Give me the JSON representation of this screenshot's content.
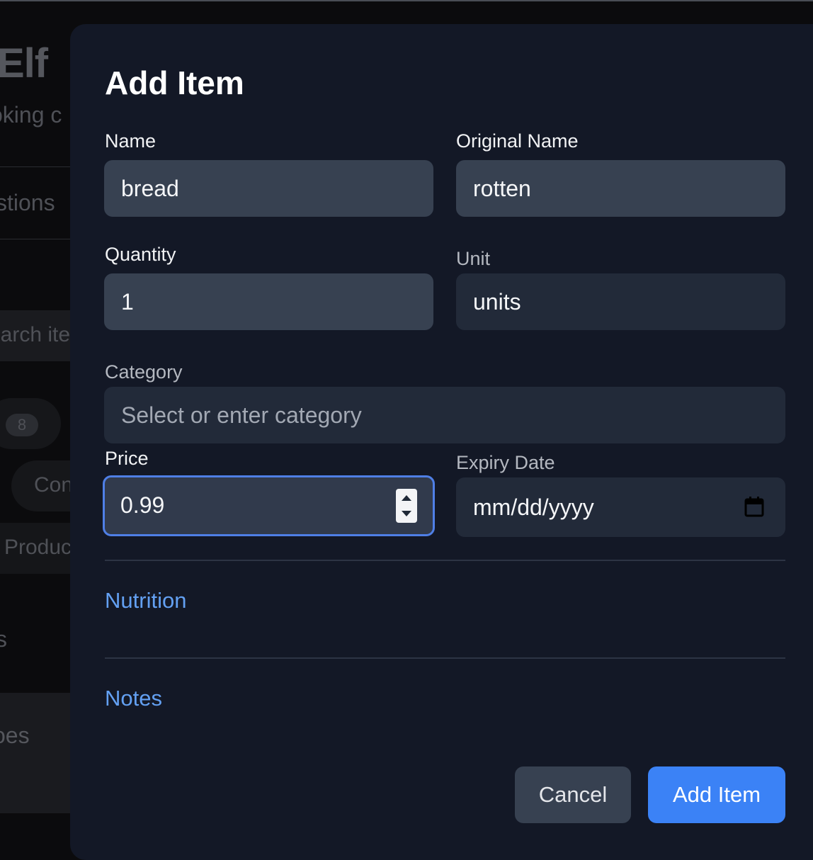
{
  "background": {
    "logo": "Elf",
    "tagline": "oking c",
    "nav_1": "stions",
    "search_placeholder": "earch ite",
    "count": "8",
    "chip": "Con",
    "products": "Produc",
    "nav_2": "s",
    "nav_3": "oes"
  },
  "modal": {
    "title": "Add Item",
    "fields": {
      "name": {
        "label": "Name",
        "value": "bread"
      },
      "original_name": {
        "label": "Original Name",
        "value": "rotten"
      },
      "quantity": {
        "label": "Quantity",
        "value": "1"
      },
      "unit": {
        "label": "Unit",
        "value": "units"
      },
      "category": {
        "label": "Category",
        "placeholder": "Select or enter category"
      },
      "price": {
        "label": "Price",
        "value": "0.99"
      },
      "expiry": {
        "label": "Expiry Date",
        "placeholder": "mm/dd/yyyy"
      }
    },
    "sections": {
      "nutrition": "Nutrition",
      "notes": "Notes"
    },
    "buttons": {
      "cancel": "Cancel",
      "submit": "Add Item"
    }
  },
  "colors": {
    "accent": "#3b82f6",
    "link": "#63a0f2",
    "modal_bg": "#131826",
    "input_bg": "#374151"
  },
  "icons": {
    "price_spinner": "stepper-icon",
    "expiry_picker": "calendar-icon"
  }
}
